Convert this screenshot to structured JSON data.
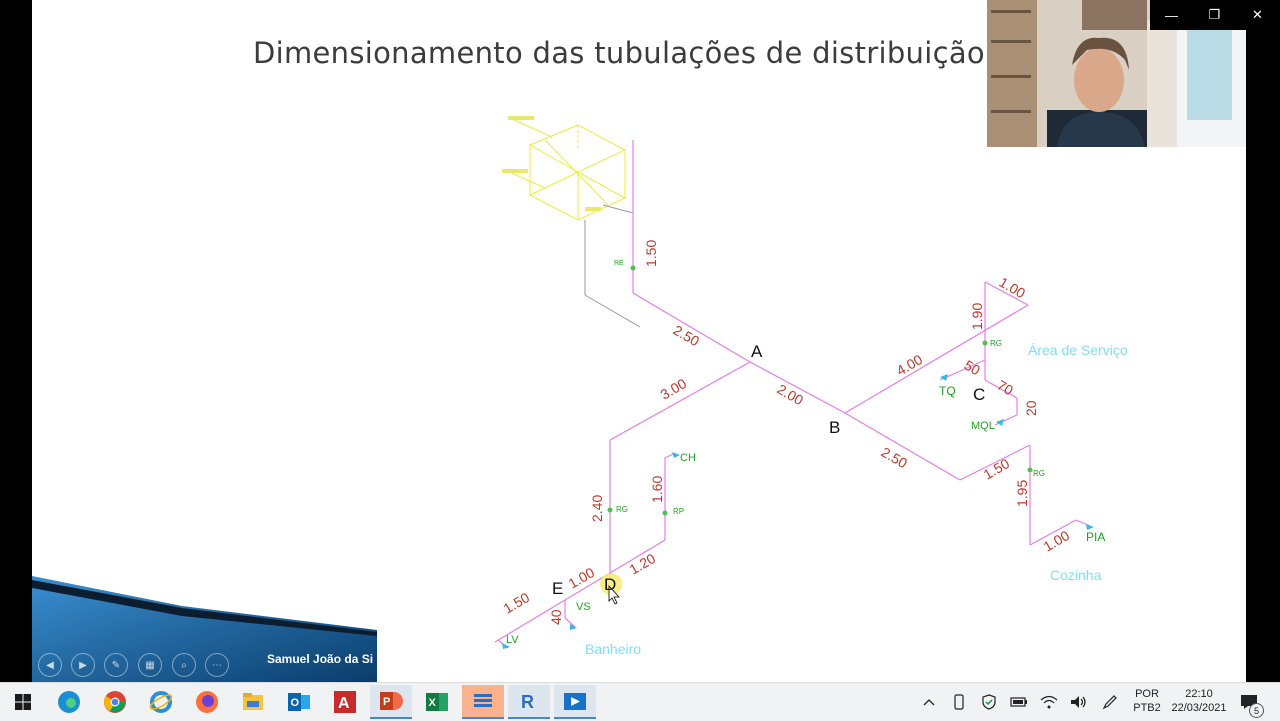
{
  "window": {
    "buttons": {
      "minimize": "—",
      "restore": "❐",
      "close": "✕"
    }
  },
  "slide": {
    "title": "Dimensionamento das tubulações de distribuição",
    "presenter_name": "Samuel João da Si",
    "colors": {
      "pipe": "#e67ee6",
      "dimension": "#c0392b",
      "fixture": "#1fa51f",
      "room": "#7fe0ee",
      "tank": "#ecec3a"
    }
  },
  "diagram": {
    "points": {
      "A": "A",
      "B": "B",
      "C": "C",
      "D": "D",
      "E": "E"
    },
    "dimensions": {
      "d_1_50_riser": "1.50",
      "d_2_50_upper": "2.50",
      "d_3_00": "3.00",
      "d_2_00": "2.00",
      "d_4_00": "4.00",
      "d_1_00_top": "1.00",
      "d_1_90": "1.90",
      "d_50": "50",
      "d_70": "70",
      "d_20": "20",
      "d_2_50_lower": "2.50",
      "d_1_50_kitchen": "1.50",
      "d_1_95": "1.95",
      "d_1_00_kitchen": "1.00",
      "d_2_40": "2.40",
      "d_1_60": "1.60",
      "d_1_20": "1.20",
      "d_1_00_bath": "1.00",
      "d_1_50_bath": "1.50",
      "d_40": "40"
    },
    "fixtures": {
      "re": "RE",
      "rg_service": "RG",
      "tq": "TQ",
      "mql": "MQL",
      "rg_kitchen": "RG",
      "pia": "PIA",
      "ch": "CH",
      "rp": "RP",
      "rg_bath": "RG",
      "vs": "VS",
      "lv": "LV"
    },
    "rooms": {
      "area_servico": "Área de Serviço",
      "cozinha": "Cozinha",
      "banheiro": "Banheiro"
    }
  },
  "presentation_controls": [
    "◀",
    "▶",
    "✎",
    "▦",
    "⌕",
    "⋯"
  ],
  "taskbar": {
    "apps": [
      "edge",
      "chrome",
      "internet-explorer",
      "firefox",
      "file-explorer",
      "outlook",
      "autocad",
      "powerpoint",
      "excel",
      "stack-app",
      "revit",
      "media-player"
    ],
    "tray": {
      "language_top": "POR",
      "language_bottom": "PTB2",
      "time": "22:10",
      "date": "22/03/2021",
      "notification_count": "5"
    }
  }
}
